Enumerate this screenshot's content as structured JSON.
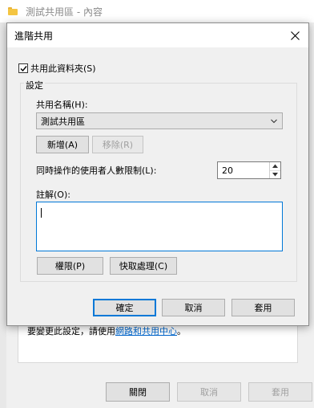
{
  "parent_window": {
    "title": "測試共用區 - 內容",
    "note_text": "要變更此設定，請使用",
    "note_link": "網路和共用中心",
    "note_suffix": "。",
    "buttons": {
      "close": "關閉",
      "cancel": "取消",
      "apply": "套用"
    }
  },
  "dialog": {
    "title": "進階共用",
    "share_checkbox": {
      "label": "共用此資料夾(S)",
      "checked": true
    },
    "settings_legend": "設定",
    "share_name_label": "共用名稱(H):",
    "share_name_value": "測試共用區",
    "add_button": "新增(A)",
    "remove_button": "移除(R)",
    "user_limit_label": "同時操作的使用者人數限制(L):",
    "user_limit_value": "20",
    "comments_label": "註解(O):",
    "comments_value": "",
    "permissions_button": "權限(P)",
    "caching_button": "快取處理(C)",
    "ok_button": "確定",
    "cancel_button": "取消",
    "apply_button": "套用"
  },
  "colors": {
    "accent": "#0078d7",
    "link": "#0066cc",
    "disabled_text": "#a0a0a0"
  },
  "icons": [
    "folder-icon",
    "close-icon",
    "checkmark-icon",
    "chevron-down-icon",
    "spin-up-icon",
    "spin-down-icon"
  ]
}
